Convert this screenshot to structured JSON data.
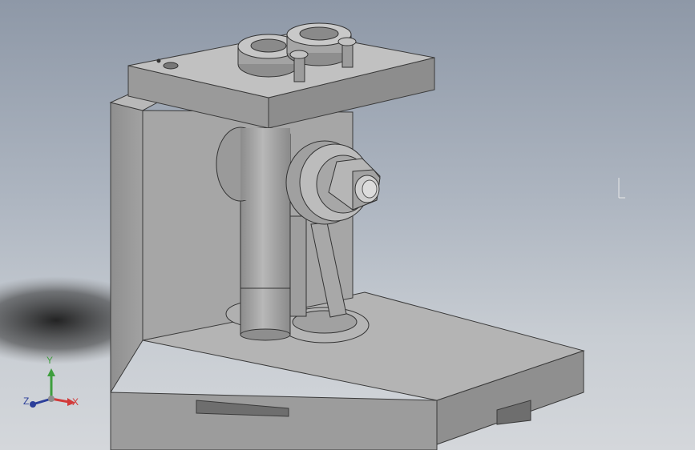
{
  "triad": {
    "x_label": "X",
    "y_label": "Y",
    "z_label": "Z",
    "x_color": "#d23a3a",
    "y_color": "#3e9e3e",
    "z_color": "#2c3f9a"
  },
  "viewport": {
    "background_top": "#8e98a7",
    "background_bottom": "#d4d7db",
    "part_color": "#a9a9a9"
  },
  "icons": {
    "model": "fixture-model-icon",
    "triad": "axis-triad-icon",
    "cursor": "cursor-marker-icon"
  }
}
